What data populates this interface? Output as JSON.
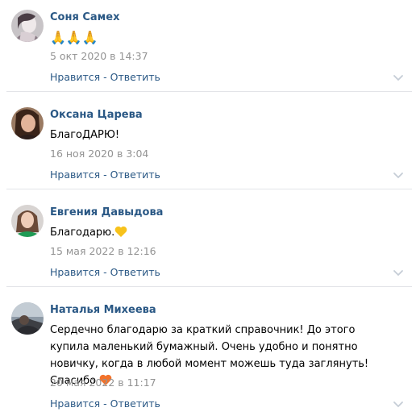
{
  "comments": [
    {
      "author": "Соня Самех",
      "text": "🙏🙏🙏",
      "date": "5 окт 2020 в 14:37",
      "like_label": "Нравится",
      "separator": "·",
      "reply_label": "Ответить",
      "avatar_icon": "avatar-photo-icon"
    },
    {
      "author": "Оксана Царева",
      "text": "БлагоДАРЮ!",
      "date": "16 ноя 2020 в 3:04",
      "like_label": "Нравится",
      "separator": "·",
      "reply_label": "Ответить",
      "avatar_icon": "avatar-photo-icon"
    },
    {
      "author": "Евгения Давыдова",
      "text": "Благодарю.",
      "text_emoji": "yellow-heart-icon",
      "date": "15 мая 2022 в 12:16",
      "like_label": "Нравится",
      "separator": "·",
      "reply_label": "Ответить",
      "avatar_icon": "avatar-photo-icon"
    },
    {
      "author": "Наталья Михеева",
      "text": "Сердечно благодарю за краткий справочник! До этого купила маленький бумажный. Очень удобно и понятно новичку, когда в любой момент можешь туда заглянуть! Спасибо",
      "text_emoji": "orange-heart-icon",
      "date": "20 мая 2022 в 11:17",
      "like_label": "Нравится",
      "separator": "·",
      "reply_label": "Ответить",
      "avatar_icon": "avatar-photo-icon"
    }
  ],
  "colors": {
    "author_link": "#2a5885",
    "date_text": "#939393",
    "divider": "#e3e4e8"
  }
}
